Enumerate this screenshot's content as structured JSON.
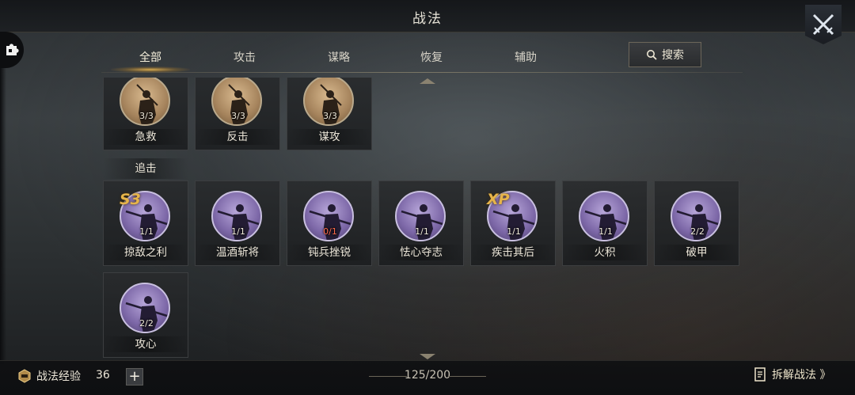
{
  "header": {
    "title": "战法"
  },
  "tabs": [
    {
      "label": "全部",
      "active": true
    },
    {
      "label": "攻击",
      "active": false
    },
    {
      "label": "谋略",
      "active": false
    },
    {
      "label": "恢复",
      "active": false
    },
    {
      "label": "辅助",
      "active": false
    }
  ],
  "search": {
    "label": "搜索"
  },
  "top_skills": [
    {
      "name": "急救",
      "count": "3/3"
    },
    {
      "name": "反击",
      "count": "3/3"
    },
    {
      "name": "谋攻",
      "count": "3/3"
    }
  ],
  "section_label": "追击",
  "pursuit_skills": [
    {
      "name": "掠敌之利",
      "count": "1/1",
      "badge": "S3"
    },
    {
      "name": "温酒斩将",
      "count": "1/1",
      "badge": ""
    },
    {
      "name": "钝兵挫锐",
      "count": "0/1",
      "badge": ""
    },
    {
      "name": "怯心夺志",
      "count": "1/1",
      "badge": ""
    },
    {
      "name": "疾击其后",
      "count": "1/1",
      "badge": "XP"
    },
    {
      "name": "火积",
      "count": "1/1",
      "badge": ""
    },
    {
      "name": "破甲",
      "count": "2/2",
      "badge": ""
    },
    {
      "name": "攻心",
      "count": "2/2",
      "badge": ""
    }
  ],
  "footer": {
    "xp_label": "战法经验",
    "xp_value": "36",
    "plus": "+",
    "capacity": "125/200",
    "decompose_label": "拆解战法 》"
  },
  "colors": {
    "accent_gold": "#e6b44a",
    "tab_glow": "#e0a848",
    "count_red": "#ff6b4a",
    "portrait_tan": "#a5835c",
    "portrait_purple": "#7c67a7"
  }
}
